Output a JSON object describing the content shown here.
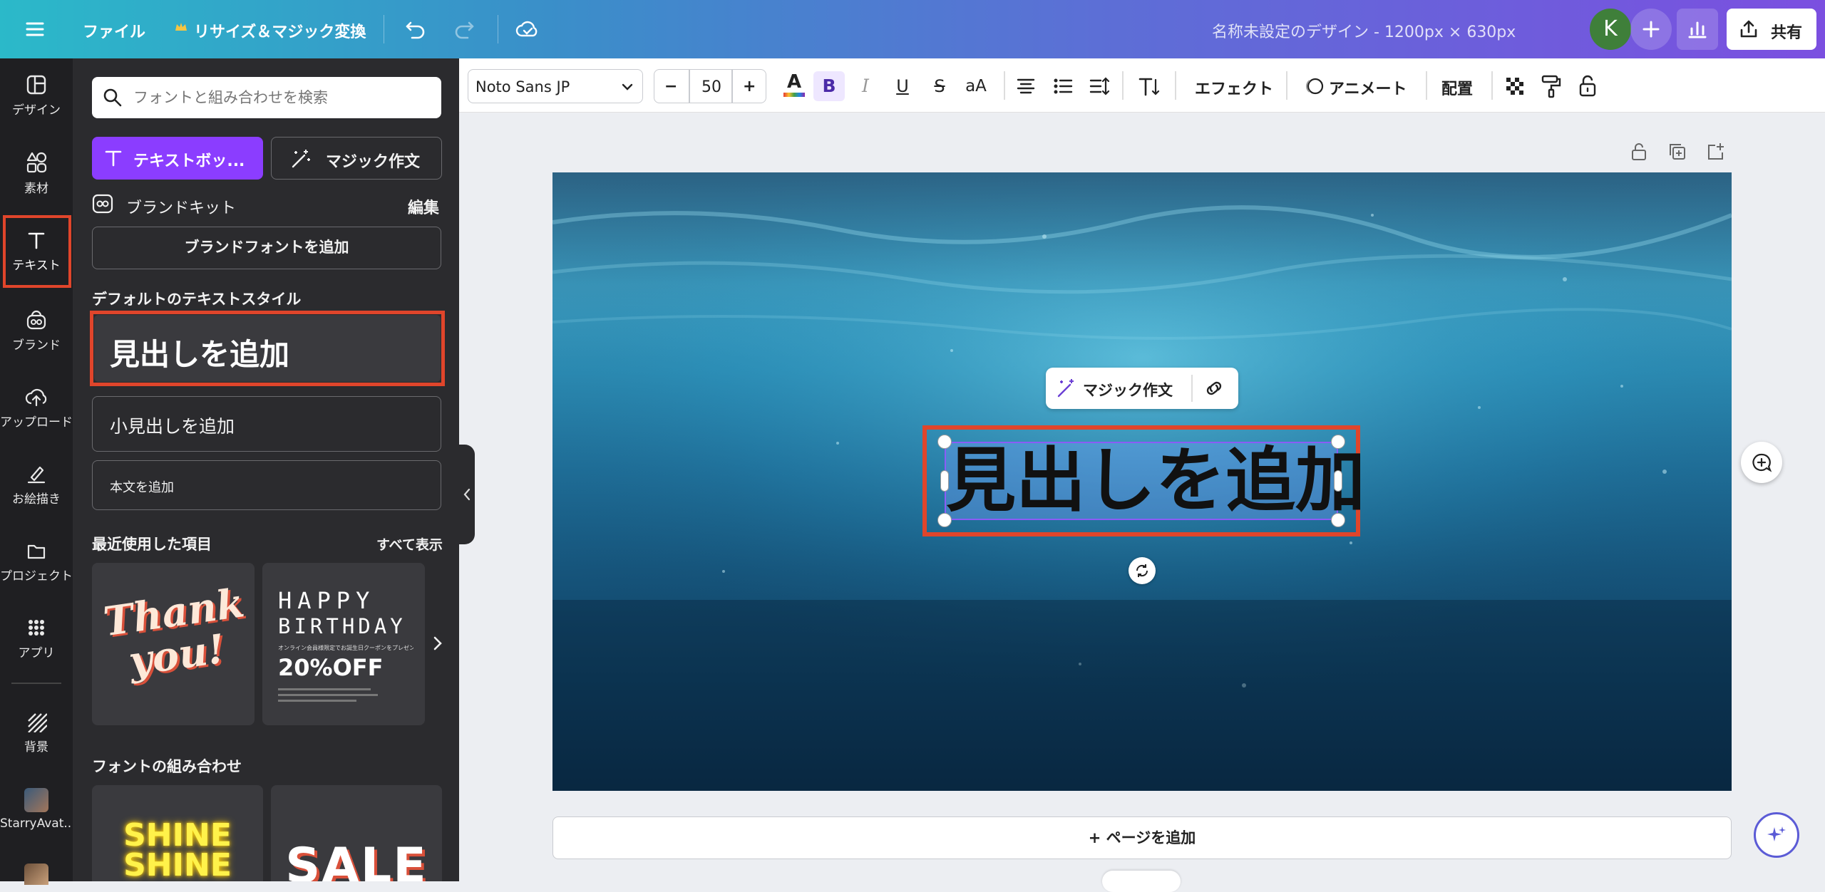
{
  "topbar": {
    "file_label": "ファイル",
    "resize_label": "リサイズ＆マジック変換",
    "doc_title": "名称未設定のデザイン - 1200px × 630px",
    "avatar_letter": "K",
    "share_label": "共有"
  },
  "sidebar": {
    "items": [
      {
        "label": "デザイン",
        "icon": "layout-icon"
      },
      {
        "label": "素材",
        "icon": "shapes-icon"
      },
      {
        "label": "テキスト",
        "icon": "text-icon"
      },
      {
        "label": "ブランド",
        "icon": "brand-icon"
      },
      {
        "label": "アップロード",
        "icon": "upload-icon"
      },
      {
        "label": "お絵描き",
        "icon": "draw-icon"
      },
      {
        "label": "プロジェクト",
        "icon": "folder-icon"
      },
      {
        "label": "アプリ",
        "icon": "apps-icon"
      },
      {
        "label": "背景",
        "icon": "background-icon"
      },
      {
        "label": "StarryAvat...",
        "icon": "app-avatar"
      }
    ]
  },
  "panel": {
    "search_placeholder": "フォントと組み合わせを検索",
    "textbox_button": "テキストボッ...",
    "magic_write_button": "マジック作文",
    "brand_kit_label": "ブランドキット",
    "edit_label": "編集",
    "add_brand_font": "ブランドフォントを追加",
    "default_styles_heading": "デフォルトのテキストスタイル",
    "heading_style": "見出しを追加",
    "subheading_style": "小見出しを追加",
    "body_style": "本文を追加",
    "recent_heading": "最近使用した項目",
    "see_all": "すべて表示",
    "recent_items": [
      {
        "line1": "Thank",
        "line2": "you!"
      },
      {
        "line1": "HAPPY",
        "line2": "BIRTHDAY",
        "small": "オンライン会員様限定でお誕生日クーポンをプレゼント！",
        "offer": "20%OFF"
      }
    ],
    "font_combos_heading": "フォントの組み合わせ",
    "font_combos": [
      {
        "line1": "SHINE",
        "line2": "SHINE"
      },
      {
        "line1": "SALE"
      }
    ]
  },
  "toolbar": {
    "font_name": "Noto Sans JP",
    "font_size": "50",
    "minus": "−",
    "plus": "+",
    "bold": "B",
    "italic": "I",
    "underline": "U",
    "strike": "S",
    "case": "aA",
    "effects_label": "エフェクト",
    "animate_label": "アニメート",
    "position_label": "配置"
  },
  "canvas": {
    "selected_text": "見出しを追加",
    "magic_write_label": "マジック作文",
    "add_page_label": "+ ページを追加"
  },
  "colors": {
    "accent": "#8b3dff",
    "highlight_border": "#e0452b",
    "selection": "#8b5cf6"
  }
}
